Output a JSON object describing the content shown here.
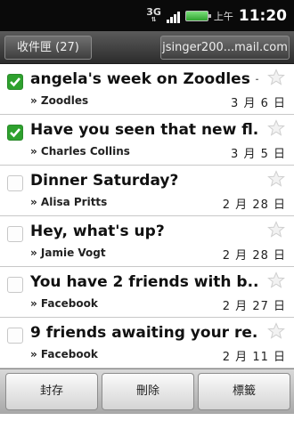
{
  "status_bar": {
    "network": "3G",
    "ampm": "上午",
    "time": "11:20"
  },
  "header": {
    "folder_label": "收件匣 (27)",
    "account_label": "jsinger200...mail.com"
  },
  "messages": [
    {
      "subject": "angela's week on Zoodles",
      "snippet": " - ...",
      "sender": "» Zoodles",
      "date": "3 月 6 日",
      "checked": true
    },
    {
      "subject": "Have you seen that new fl...",
      "snippet": "",
      "sender": "» Charles Collins",
      "date": "3 月 5 日",
      "checked": true
    },
    {
      "subject": "Dinner Saturday?",
      "snippet": "",
      "sender": "» Alisa Pritts",
      "date": "2 月 28 日",
      "checked": false
    },
    {
      "subject": "Hey, what's up?",
      "snippet": "",
      "sender": "» Jamie Vogt",
      "date": "2 月 28 日",
      "checked": false
    },
    {
      "subject": "You have 2 friends with b...",
      "snippet": "",
      "sender": "» Facebook",
      "date": "2 月 27 日",
      "checked": false
    },
    {
      "subject": "9 friends awaiting your re...",
      "snippet": "",
      "sender": "» Facebook",
      "date": "2 月 11 日",
      "checked": false
    }
  ],
  "actions": {
    "archive_label": "封存",
    "delete_label": "刪除",
    "labels_label": "標籤"
  },
  "colors": {
    "check_green": "#2ea12e",
    "status_bar": "#0a0a0a",
    "header": "#3c3c3c"
  }
}
